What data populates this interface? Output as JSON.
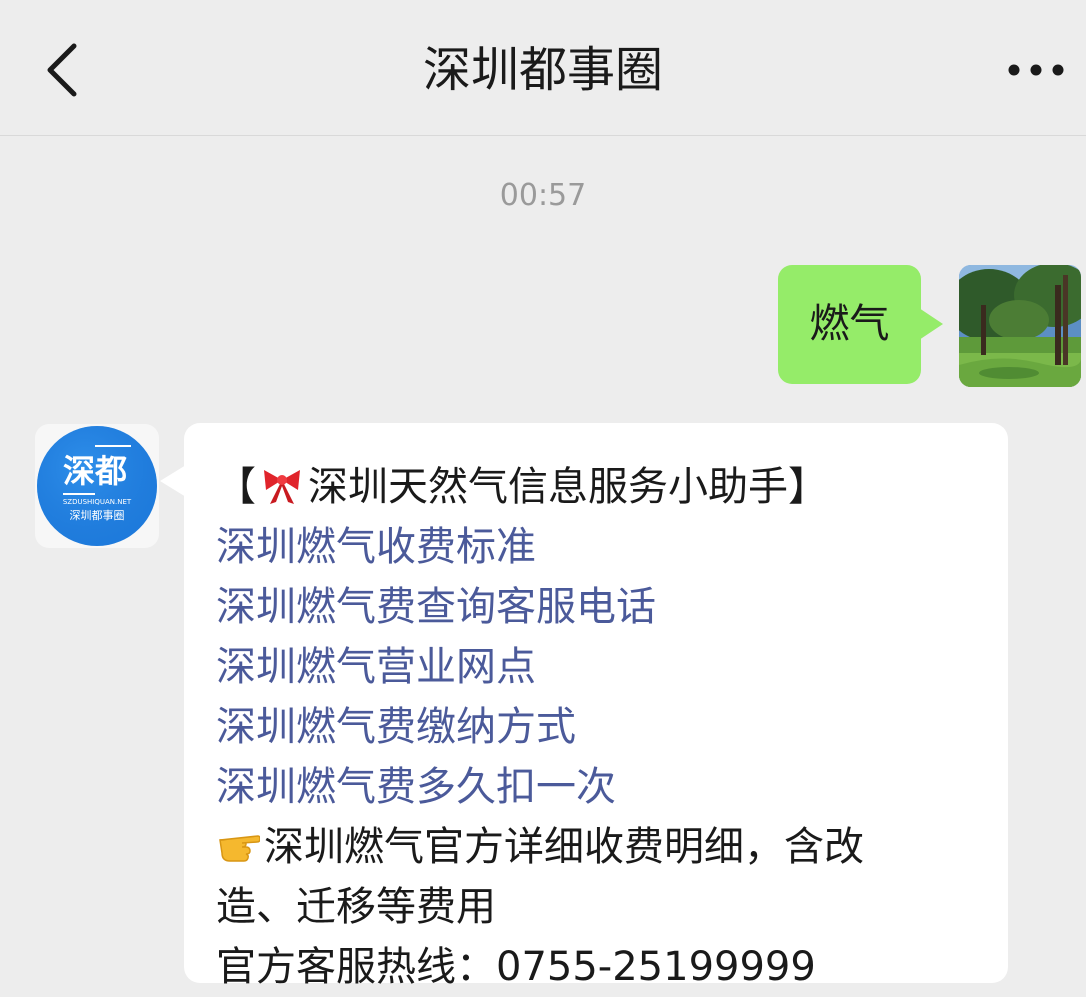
{
  "header": {
    "title": "深圳都事圈",
    "back_icon": "chevron-left-icon",
    "more_icon": "more-dots-icon"
  },
  "chat": {
    "timestamp": "00:57",
    "outgoing": {
      "text": "燃气",
      "bubble_color": "#95ec69"
    },
    "incoming": {
      "bracket_open": "【",
      "title_icon": "ribbon-bow-icon",
      "title": "深圳天然气信息服务小助手",
      "bracket_close": "】",
      "link_color": "#4b5a9a",
      "links": [
        "深圳燃气收费标准",
        "深圳燃气费查询客服电话",
        "深圳燃气营业网点",
        "深圳燃气费缴纳方式",
        "深圳燃气费多久扣一次"
      ],
      "pointer_icon": "pointing-hand-icon",
      "detail_text": "深圳燃气官方详细收费明细，含改造、迁移等费用",
      "hotline_text": "官方客服热线：0755-25199999"
    }
  },
  "avatars": {
    "bot_logo_title": "深都",
    "bot_logo_subtitle": "SZDUSHIQUAN.NET",
    "bot_logo_caption": "深圳都事圈",
    "bot_logo_color": "#1f7fe0"
  }
}
